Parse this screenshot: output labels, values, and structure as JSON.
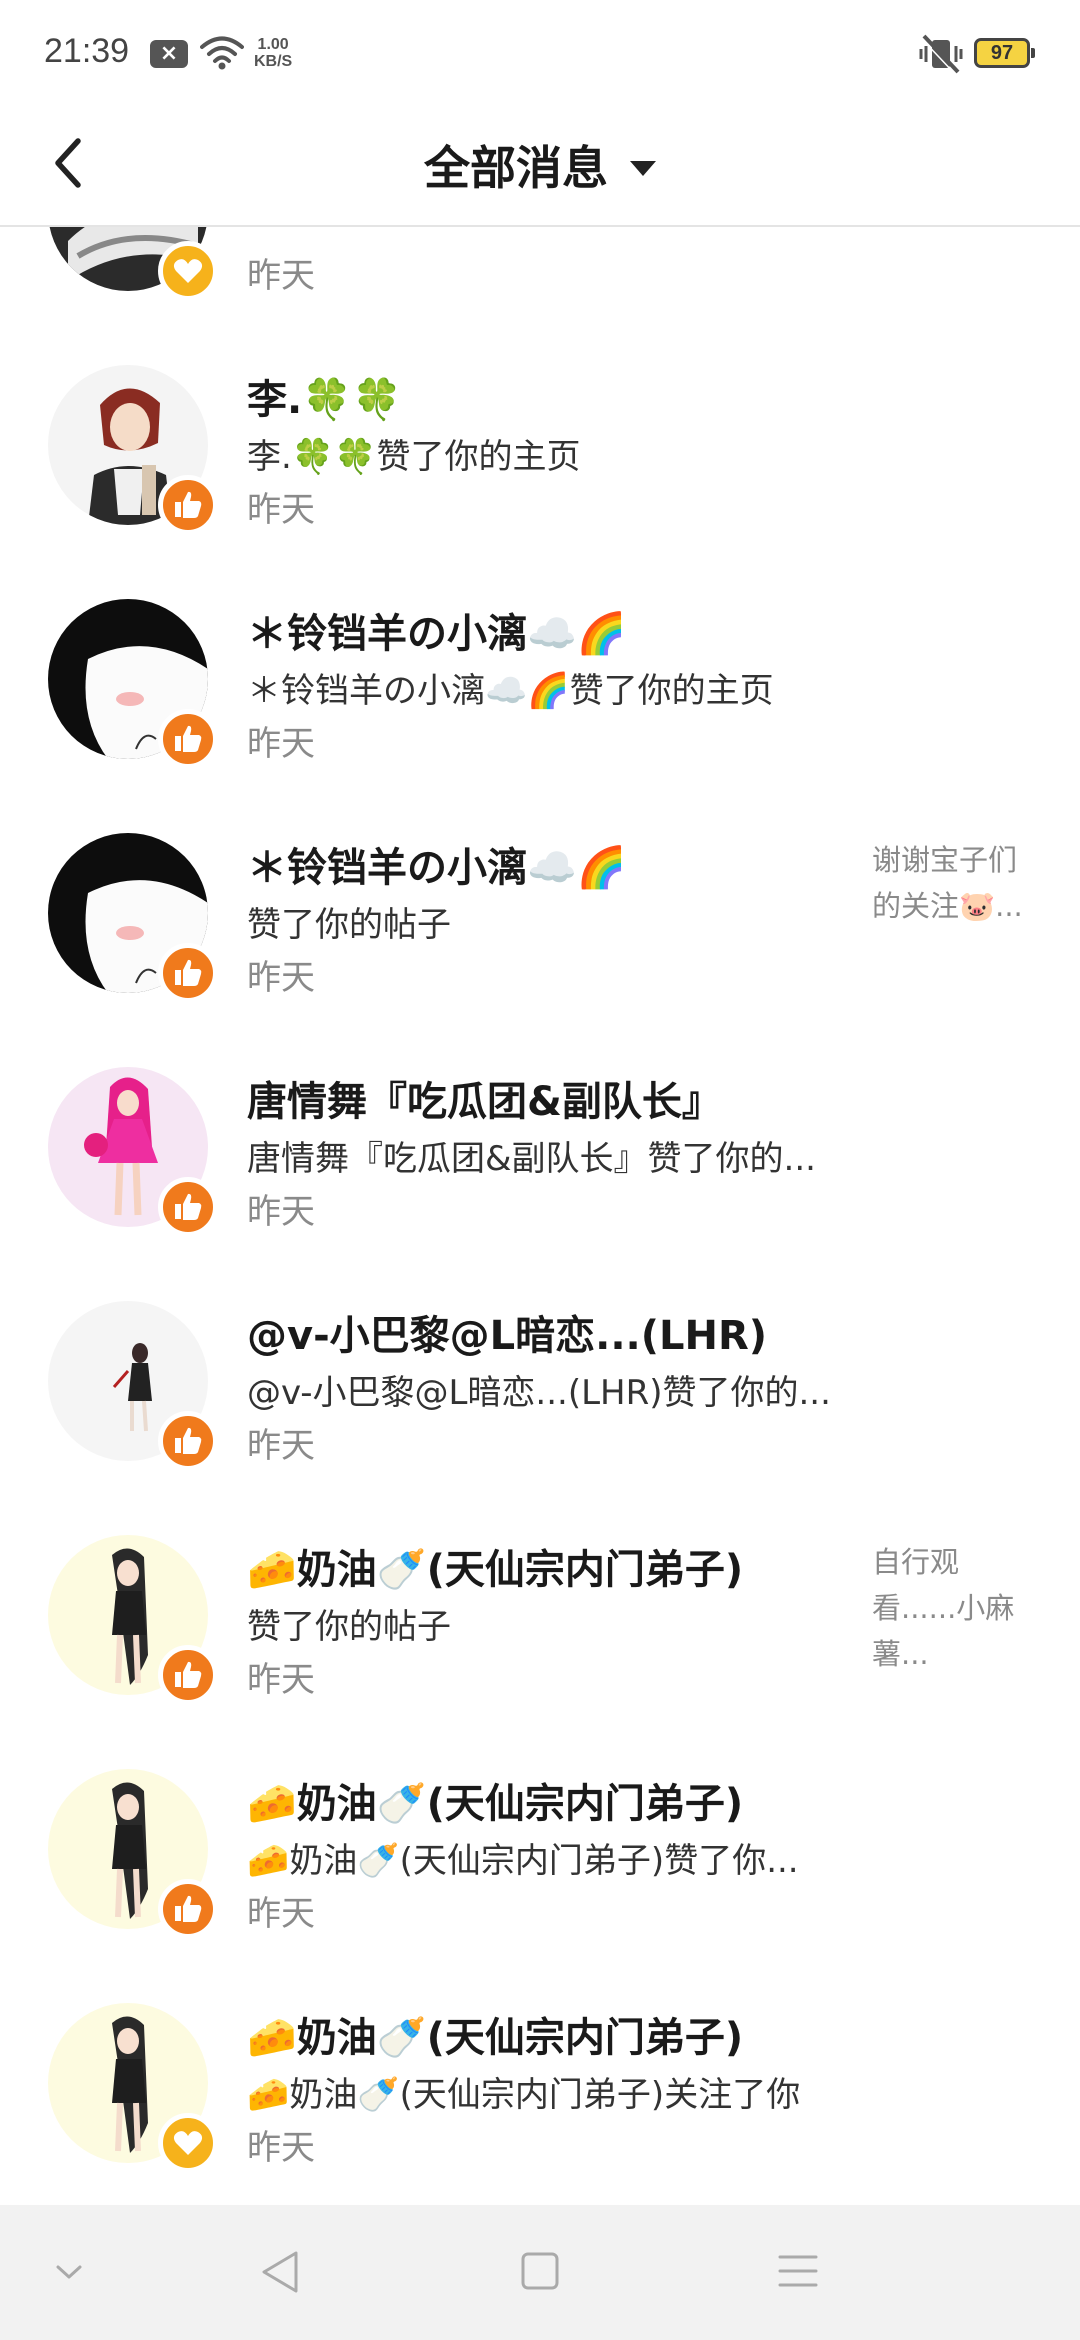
{
  "status_bar": {
    "time": "21:39",
    "x_badge": "×",
    "speed_value": "1.00",
    "speed_unit": "KB/S",
    "battery": "97",
    "icons": [
      "close-notification-icon",
      "wifi-icon",
      "mute-vibrate-icon",
      "battery-icon"
    ]
  },
  "header": {
    "title": "全部消息",
    "back_icon": "chevron-left-icon",
    "dropdown_icon": "triangle-down-icon"
  },
  "colors": {
    "badge_orange": "#f07a1c",
    "secondary_text": "#8a8a8a",
    "bottom_bar": "#f2f2f2"
  },
  "messages": [
    {
      "name": "",
      "message": "",
      "time": "昨天",
      "preview": "",
      "badge": "heart-icon",
      "partially_visible": true
    },
    {
      "name": "李.🍀🍀",
      "message": "李.🍀🍀赞了你的主页",
      "time": "昨天",
      "preview": "",
      "badge": "thumbs-up-icon"
    },
    {
      "name": "＊铃铛羊の小漓☁️🌈",
      "message": "＊铃铛羊の小漓☁️🌈赞了你的主页",
      "time": "昨天",
      "preview": "",
      "badge": "thumbs-up-icon"
    },
    {
      "name": "＊铃铛羊の小漓☁️🌈",
      "message": "赞了你的帖子",
      "time": "昨天",
      "preview": "谢谢宝子们的关注🐷...",
      "badge": "thumbs-up-icon"
    },
    {
      "name": "唐情舞『吃瓜团&副队长』",
      "message": "唐情舞『吃瓜团&副队长』赞了你的...",
      "time": "昨天",
      "preview": "",
      "badge": "thumbs-up-icon"
    },
    {
      "name": "@v-小巴黎@L暗恋...(LHR)",
      "message": "@v-小巴黎@L暗恋...(LHR)赞了你的...",
      "time": "昨天",
      "preview": "",
      "badge": "thumbs-up-icon"
    },
    {
      "name": "🧀奶油🍼(天仙宗内门弟子)",
      "message": "赞了你的帖子",
      "time": "昨天",
      "preview": "自行观看......小麻薯...",
      "badge": "thumbs-up-icon"
    },
    {
      "name": "🧀奶油🍼(天仙宗内门弟子)",
      "message": "🧀奶油🍼(天仙宗内门弟子)赞了你...",
      "time": "昨天",
      "preview": "",
      "badge": "thumbs-up-icon"
    },
    {
      "name": "🧀奶油🍼(天仙宗内门弟子)",
      "message": "🧀奶油🍼(天仙宗内门弟子)关注了你",
      "time": "昨天",
      "preview": "",
      "badge": "heart-icon"
    }
  ],
  "bottom_nav": {
    "icons": [
      "collapse-down-icon",
      "back-triangle-icon",
      "home-square-icon",
      "menu-lines-icon"
    ]
  }
}
